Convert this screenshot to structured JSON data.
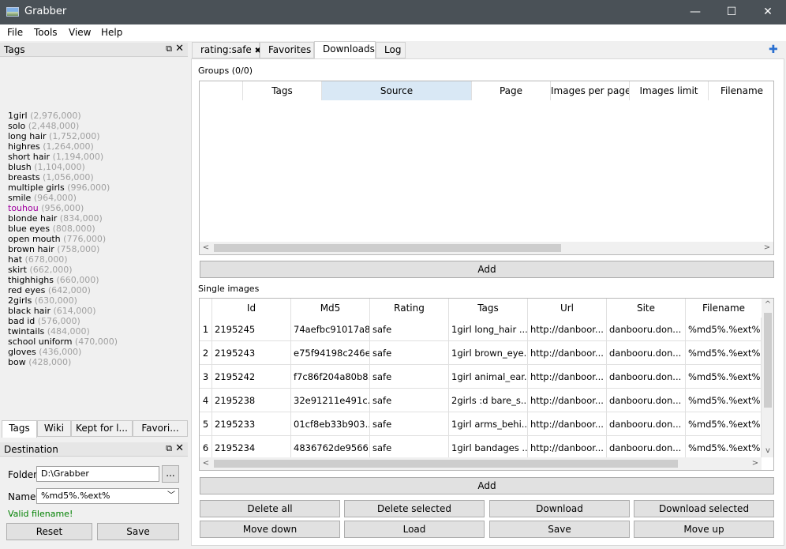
{
  "window": {
    "title": "Grabber",
    "minimize": "—",
    "maximize": "☐",
    "close": "✕"
  },
  "menu": [
    "File",
    "Tools",
    "View",
    "Help"
  ],
  "tags_dock": {
    "title": "Tags",
    "float_icon": "⧉",
    "close_icon": "✕",
    "tags": [
      {
        "name": "1girl",
        "count": "(2,976,000)",
        "color": "#000000"
      },
      {
        "name": "solo",
        "count": "(2,448,000)",
        "color": "#000000"
      },
      {
        "name": "long hair",
        "count": "(1,752,000)",
        "color": "#000000"
      },
      {
        "name": "highres",
        "count": "(1,264,000)",
        "color": "#000000"
      },
      {
        "name": "short hair",
        "count": "(1,194,000)",
        "color": "#000000"
      },
      {
        "name": "blush",
        "count": "(1,104,000)",
        "color": "#000000"
      },
      {
        "name": "breasts",
        "count": "(1,056,000)",
        "color": "#000000"
      },
      {
        "name": "multiple girls",
        "count": "(996,000)",
        "color": "#000000"
      },
      {
        "name": "smile",
        "count": "(964,000)",
        "color": "#000000"
      },
      {
        "name": "touhou",
        "count": "(956,000)",
        "color": "#a000a0"
      },
      {
        "name": "blonde hair",
        "count": "(834,000)",
        "color": "#000000"
      },
      {
        "name": "blue eyes",
        "count": "(808,000)",
        "color": "#000000"
      },
      {
        "name": "open mouth",
        "count": "(776,000)",
        "color": "#000000"
      },
      {
        "name": "brown hair",
        "count": "(758,000)",
        "color": "#000000"
      },
      {
        "name": "hat",
        "count": "(678,000)",
        "color": "#000000"
      },
      {
        "name": "skirt",
        "count": "(662,000)",
        "color": "#000000"
      },
      {
        "name": "thighhighs",
        "count": "(660,000)",
        "color": "#000000"
      },
      {
        "name": "red eyes",
        "count": "(642,000)",
        "color": "#000000"
      },
      {
        "name": "2girls",
        "count": "(630,000)",
        "color": "#000000"
      },
      {
        "name": "black hair",
        "count": "(614,000)",
        "color": "#000000"
      },
      {
        "name": "bad id",
        "count": "(576,000)",
        "color": "#000000"
      },
      {
        "name": "twintails",
        "count": "(484,000)",
        "color": "#000000"
      },
      {
        "name": "school uniform",
        "count": "(470,000)",
        "color": "#000000"
      },
      {
        "name": "gloves",
        "count": "(436,000)",
        "color": "#000000"
      },
      {
        "name": "bow",
        "count": "(428,000)",
        "color": "#000000"
      }
    ],
    "bottom_tabs": [
      "Tags",
      "Wiki",
      "Kept for l...",
      "Favori..."
    ]
  },
  "destination": {
    "title": "Destination",
    "float_icon": "⧉",
    "close_icon": "✕",
    "folder_label": "Folder",
    "folder_value": "D:\\Grabber",
    "browse": "...",
    "name_label": "Name",
    "name_value": "%md5%.%ext%",
    "status": "Valid filename!",
    "status_color": "#008000",
    "reset": "Reset",
    "save": "Save"
  },
  "tabs": [
    {
      "label": "rating:safe",
      "close": "✖"
    },
    {
      "label": "Favorites"
    },
    {
      "label": "Downloads"
    },
    {
      "label": "Log"
    }
  ],
  "add_tab_icon": "✚",
  "groups": {
    "label": "Groups (0/0)",
    "columns": [
      "",
      "Tags",
      "Source",
      "Page",
      "Images per page",
      "Images limit",
      "Filename"
    ],
    "add": "Add"
  },
  "single": {
    "label": "Single images",
    "columns": [
      "Id",
      "Md5",
      "Rating",
      "Tags",
      "Url",
      "Site",
      "Filename"
    ],
    "rows": [
      {
        "n": "1",
        "cells": [
          "2195245",
          "74aefbc91017a8...",
          "safe",
          "1girl long_hair ...",
          "http://danboor...",
          "danbooru.don...",
          "%md5%.%ext%"
        ]
      },
      {
        "n": "2",
        "cells": [
          "2195243",
          "e75f94198c246e...",
          "safe",
          "1girl brown_eye...",
          "http://danboor...",
          "danbooru.don...",
          "%md5%.%ext%"
        ]
      },
      {
        "n": "3",
        "cells": [
          "2195242",
          "f7c86f204a80b8...",
          "safe",
          "1girl animal_ear...",
          "http://danboor...",
          "danbooru.don...",
          "%md5%.%ext%"
        ]
      },
      {
        "n": "4",
        "cells": [
          "2195238",
          "32e91211e491c...",
          "safe",
          "2girls :d bare_s...",
          "http://danboor...",
          "danbooru.don...",
          "%md5%.%ext%"
        ]
      },
      {
        "n": "5",
        "cells": [
          "2195233",
          "01cf8eb33b903...",
          "safe",
          "1girl arms_behi...",
          "http://danboor...",
          "danbooru.don...",
          "%md5%.%ext%"
        ]
      },
      {
        "n": "6",
        "cells": [
          "2195234",
          "4836762de9566...",
          "safe",
          "1girl bandages ...",
          "http://danboor...",
          "danbooru.don...",
          "%md5%.%ext%"
        ]
      }
    ],
    "add": "Add"
  },
  "actions": {
    "delete_all": "Delete all",
    "delete_selected": "Delete selected",
    "download": "Download",
    "download_selected": "Download selected",
    "move_down": "Move down",
    "load": "Load",
    "save": "Save",
    "move_up": "Move up"
  },
  "scroll_icons": {
    "left": "<",
    "right": ">",
    "up": "^",
    "down": "v"
  }
}
